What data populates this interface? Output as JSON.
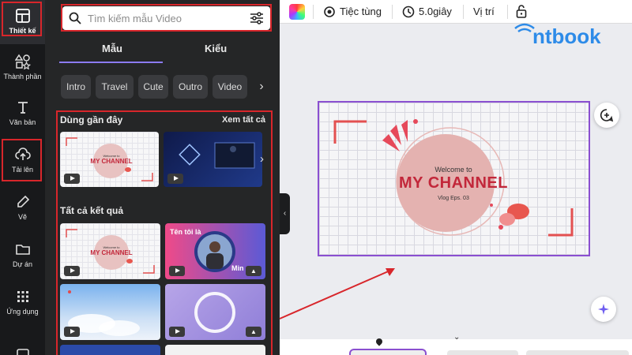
{
  "rail": {
    "items": [
      {
        "label": "Thiết kế",
        "icon": "layout-icon"
      },
      {
        "label": "Thành phần",
        "icon": "shapes-icon"
      },
      {
        "label": "Văn bản",
        "icon": "text-icon"
      },
      {
        "label": "Tải lên",
        "icon": "cloud-upload-icon"
      },
      {
        "label": "Vẽ",
        "icon": "pen-icon"
      },
      {
        "label": "Dự án",
        "icon": "folder-icon"
      },
      {
        "label": "Ứng dụng",
        "icon": "apps-grid-icon"
      }
    ]
  },
  "panel": {
    "search_placeholder": "Tìm kiếm mẫu Video",
    "tabs": [
      "Mẫu",
      "Kiểu"
    ],
    "chips": [
      "Intro",
      "Travel",
      "Cute",
      "Outro",
      "Video"
    ],
    "recent_title": "Dùng gần đây",
    "see_all": "Xem tất cả",
    "results_title": "Tất cả kết quả",
    "thumb_welcome": "Welcome to",
    "thumb_channel": "MY CHANNEL",
    "thumb_name_label": "Tên tôi là",
    "thumb_name_partial": "Min"
  },
  "topbar": {
    "animation_label": "Tiệc tùng",
    "duration_label": "5.0giây",
    "position_label": "Vị trí"
  },
  "brand": {
    "text": "ntbook"
  },
  "canvas": {
    "welcome": "Welcome to",
    "title": "MY CHANNEL",
    "subtitle": "Vlog Eps. 03"
  },
  "colors": {
    "accent": "#8b7bf5",
    "highlight": "#d8262b",
    "title": "#c2273a",
    "circle": "#e4b2b0",
    "brand": "#2d8be8"
  }
}
